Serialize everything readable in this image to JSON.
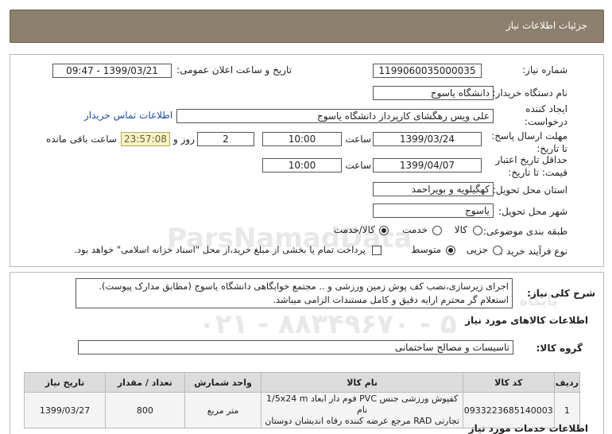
{
  "header": {
    "title": "جزئیات اطلاعات نیاز"
  },
  "form": {
    "need_number_label": "شماره نیاز:",
    "need_number": "1199060035000035",
    "announce_label": "تاریخ و ساعت اعلان عمومی:",
    "announce_value": "1399/03/21 - 09:47",
    "buyer_label": "نام دستگاه خریدار:",
    "buyer_value": "دانشگاه یاسوج",
    "requester_label_1": "ایجاد کننده",
    "requester_label_2": "درخواست:",
    "requester_value": "علی ویس رهگشای کارپرداز دانشگاه یاسوج",
    "contact_link": "اطلاعات تماس خریدار",
    "deadline_label_1": "مهلت ارسال پاسخ:",
    "deadline_label_2": "تا تاریخ:",
    "deadline_date": "1399/03/24",
    "time_label": "ساعت",
    "deadline_time": "10:00",
    "days_value": "2",
    "days_label": "روز و",
    "remaining_time": "23:57:08",
    "remaining_label": "ساعت باقی مانده",
    "validity_label_1": "حداقل تاریخ اعتبار",
    "validity_label_2": "قیمت: تا تاریخ:",
    "validity_date": "1399/04/07",
    "validity_time": "10:00",
    "province_label": "استان محل تحویل:",
    "province_value": "کهگیلویه و بویراحمد",
    "city_label": "شهر محل تحویل:",
    "city_value": "یاسوج",
    "category_label": "طبقه بندی موضوعی:",
    "category_options": [
      "کالا",
      "خدمت",
      "کالا/خدمت"
    ],
    "process_label": "نوع فرآیند خرید :",
    "process_options": [
      "جزیی",
      "متوسط"
    ],
    "payment_note": "پرداخت تمام یا بخشی از مبلغ خرید،از محل \"اسناد خزانه اسلامی\" خواهد بود."
  },
  "description": {
    "label": "شرح کلی نیاز:",
    "line1": "اجرای زیرسازی،نصب کف پوش زمین ورزشی و ..  مجتمع خوابگاهی دانشگاه یاسوج (مطابق مدارک پیوست).",
    "line2": "استعلام گر محترم ارایه دقیق و کامل مستندات الزامی میباشد."
  },
  "goods": {
    "section_title": "اطلاعات کالاهای مورد نیاز",
    "group_label": "گروه کالا:",
    "group_value": "تاسیسات و مصالح ساختمانی",
    "columns": [
      "ردیف",
      "کد کالا",
      "نام کالا",
      "واحد شمارش",
      "تعداد / مقدار",
      "تاریخ نیاز"
    ],
    "rows": [
      {
        "index": "1",
        "code": "0933223685140003",
        "name_line1": "کفپوش ورزشی جنس PVC فوم دار ابعاد 1/5x24 m نام",
        "name_line2": "تجارتی RAD مرجع عرضه کننده رفاه اندیشان دوستان",
        "unit": "متر مربع",
        "qty": "800",
        "date": "1399/03/27"
      }
    ]
  },
  "services": {
    "section_title": "اطلاعات خدمات مورد نیاز"
  },
  "watermark": {
    "brand": "ParsNamadData",
    "phone": "۰۲۱ - ۸۸۳۴۹۶۷۰ - ۵",
    "tagline": "پایگاه اطلاع رسانی مناقصه و مزایده"
  }
}
